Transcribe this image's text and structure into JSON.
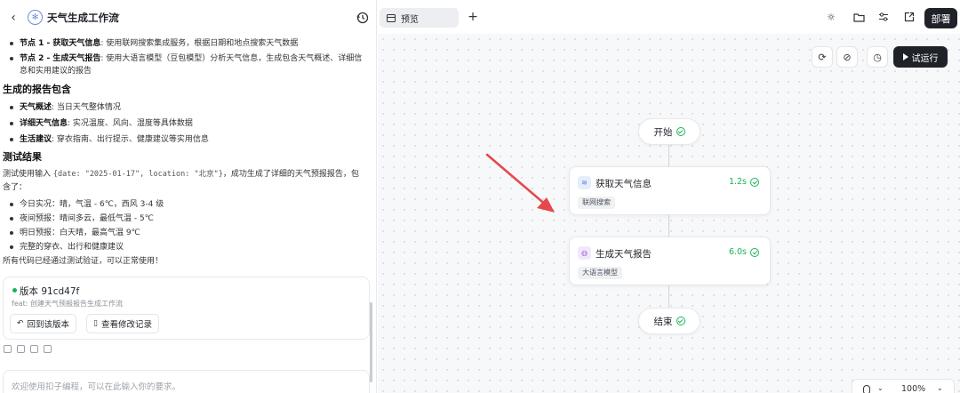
{
  "header": {
    "title": "天气生成工作流"
  },
  "chat": {
    "node_items": [
      {
        "bold": "节点 1 - 获取天气信息",
        "text": ": 使用联网搜索集成服务，根据日期和地点搜索天气数据"
      },
      {
        "bold": "节点 2 - 生成天气报告",
        "text": ": 使用大语言模型（豆包模型）分析天气信息，生成包含天气概述、详细信息和实用建议的报告"
      }
    ],
    "report_heading": "生成的报告包含",
    "report_items": [
      {
        "bold": "天气概述",
        "text": ": 当日天气整体情况"
      },
      {
        "bold": "详细天气信息",
        "text": ": 实况温度、风向、湿度等具体数据"
      },
      {
        "bold": "生活建议",
        "text": ": 穿衣指南、出行提示、健康建议等实用信息"
      }
    ],
    "test_heading": "测试结果",
    "test_prefix": "测试使用输入 ",
    "test_code": "{date: \"2025-01-17\", location: \"北京\"}",
    "test_suffix": "，成功生成了详细的天气预报报告，包含了：",
    "test_items": [
      "今日实况：晴，气温 - 6℃，西风 3-4 级",
      "夜间预报：晴间多云，最低气温 - 5℃",
      "明日预报：白天晴，最高气温 9℃",
      "完整的穿衣、出行和健康建议"
    ],
    "final_line": "所有代码已经通过测试验证，可以正常使用！"
  },
  "version": {
    "title": "版本 91cd47f",
    "subtitle": "feat: 创建天气预报报告生成工作流",
    "rollback_label": "回到该版本",
    "changelog_label": "查看修改记录"
  },
  "input": {
    "placeholder": "欢迎使用扣子编程，可以在此输入你的要求。"
  },
  "toolbar": {
    "preview_tab": "预览",
    "deploy_label": "部署",
    "run_label": "试运行"
  },
  "workflow": {
    "start_label": "开始",
    "end_label": "结束",
    "nodes": [
      {
        "title": "获取天气信息",
        "time": "1.2s",
        "tag": "联网搜索"
      },
      {
        "title": "生成天气报告",
        "time": "6.0s",
        "tag": "大语言模型"
      }
    ]
  },
  "zoom": {
    "label": "100%"
  },
  "colors": {
    "accent": "#1f2329",
    "success": "#19b35a",
    "arrow": "#e5484d"
  }
}
